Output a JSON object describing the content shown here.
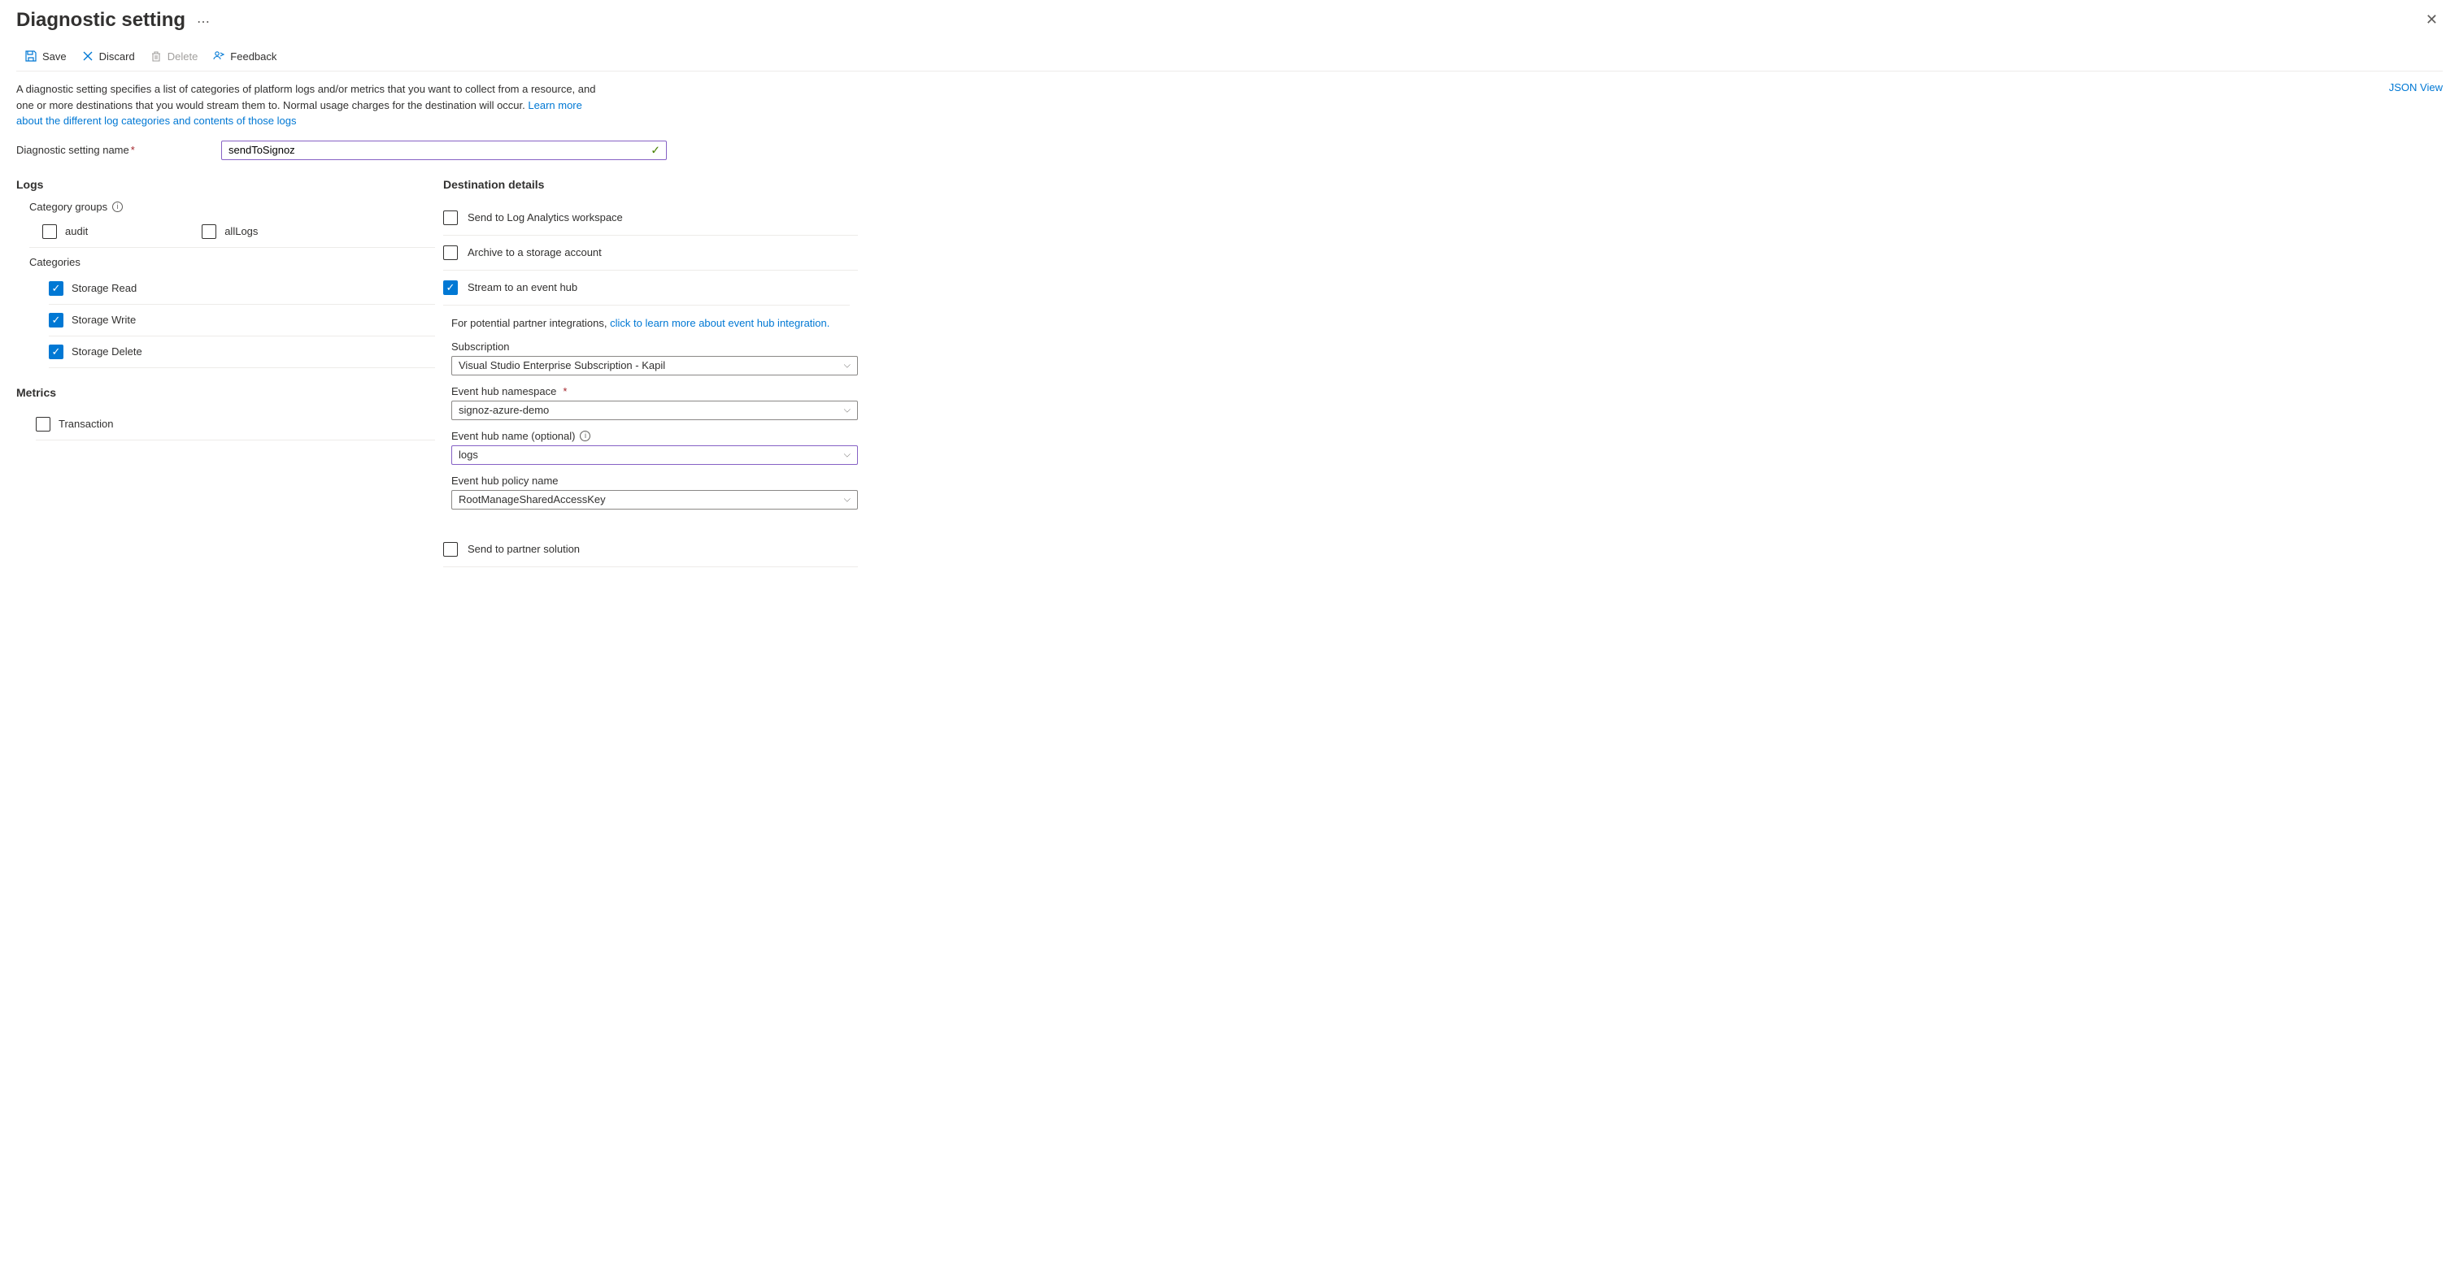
{
  "header": {
    "title": "Diagnostic setting",
    "json_view": "JSON View"
  },
  "toolbar": {
    "save": "Save",
    "discard": "Discard",
    "delete": "Delete",
    "feedback": "Feedback"
  },
  "description": {
    "text": "A diagnostic setting specifies a list of categories of platform logs and/or metrics that you want to collect from a resource, and one or more destinations that you would stream them to. Normal usage charges for the destination will occur. ",
    "link": "Learn more about the different log categories and contents of those logs"
  },
  "name_field": {
    "label": "Diagnostic setting name",
    "value": "sendToSignoz"
  },
  "logs": {
    "heading": "Logs",
    "category_groups_label": "Category groups",
    "groups": {
      "audit": "audit",
      "allLogs": "allLogs"
    },
    "categories_label": "Categories",
    "categories": {
      "read": "Storage Read",
      "write": "Storage Write",
      "delete": "Storage Delete"
    }
  },
  "metrics": {
    "heading": "Metrics",
    "transaction": "Transaction"
  },
  "dest": {
    "heading": "Destination details",
    "log_analytics": "Send to Log Analytics workspace",
    "storage": "Archive to a storage account",
    "event_hub": "Stream to an event hub",
    "partner": "Send to partner solution",
    "eh_note_prefix": "For potential partner integrations, ",
    "eh_note_link": "click to learn more about event hub integration.",
    "subscription": {
      "label": "Subscription",
      "value": "Visual Studio Enterprise Subscription - Kapil"
    },
    "namespace": {
      "label": "Event hub namespace",
      "value": "signoz-azure-demo"
    },
    "hub_name": {
      "label": "Event hub name (optional)",
      "value": "logs"
    },
    "policy": {
      "label": "Event hub policy name",
      "value": "RootManageSharedAccessKey"
    }
  }
}
